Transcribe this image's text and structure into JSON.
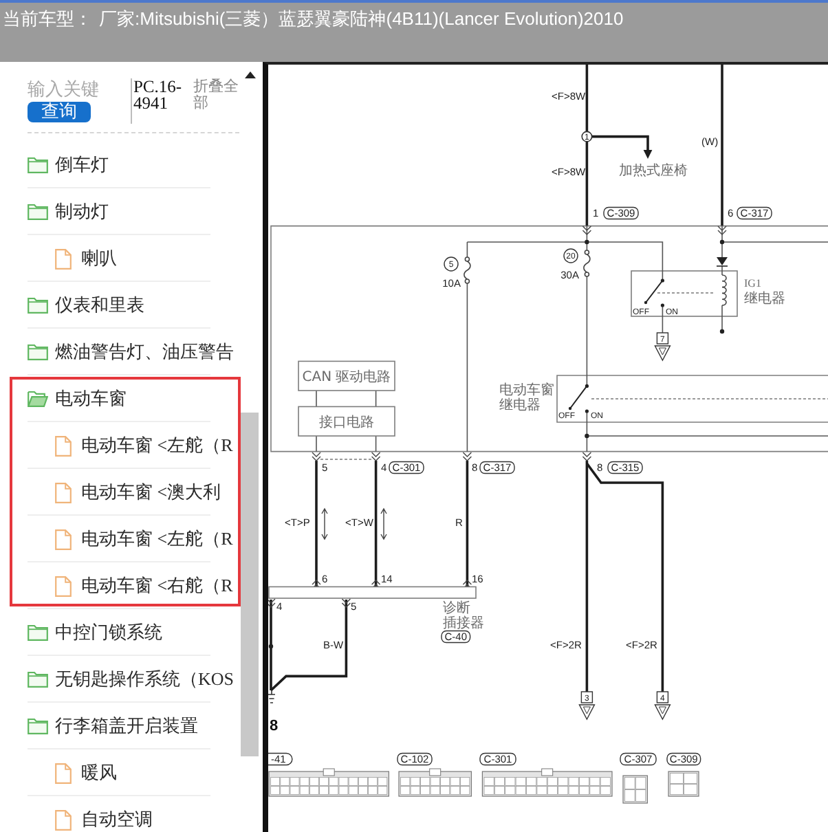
{
  "title_bar": {
    "label": "当前车型：",
    "value": "厂家:Mitsubishi(三菱）蓝瑟翼豪陆神(4B11)(Lancer Evolution)2010"
  },
  "sidebar": {
    "search": {
      "placeholder": "输入关键",
      "button": "查询"
    },
    "code": "PC.16-4941",
    "collapse_all": "折叠全部",
    "tree": [
      {
        "label": "倒车灯",
        "kind": "folder",
        "expanded": false,
        "highlighted": false
      },
      {
        "label": "制动灯",
        "kind": "folder",
        "expanded": false,
        "highlighted": false,
        "children": [
          {
            "label": "喇叭",
            "kind": "file"
          }
        ]
      },
      {
        "label": "仪表和里表",
        "kind": "folder",
        "expanded": false,
        "highlighted": false
      },
      {
        "label": "燃油警告灯、油压警告",
        "kind": "folder",
        "expanded": false,
        "highlighted": false
      },
      {
        "label": "电动车窗",
        "kind": "folder",
        "expanded": true,
        "highlighted": true,
        "children": [
          {
            "label": "电动车窗 <左舵（R",
            "kind": "file"
          },
          {
            "label": "电动车窗 <澳大利",
            "kind": "file"
          },
          {
            "label": "电动车窗 <左舵（R",
            "kind": "file"
          },
          {
            "label": "电动车窗 <右舵（R",
            "kind": "file"
          }
        ]
      },
      {
        "label": "中控门锁系统",
        "kind": "folder",
        "expanded": false,
        "highlighted": false
      },
      {
        "label": "无钥匙操作系统（KOS",
        "kind": "folder",
        "expanded": false,
        "highlighted": false
      },
      {
        "label": "行李箱盖开启装置",
        "kind": "folder",
        "expanded": false,
        "highlighted": false,
        "children": [
          {
            "label": "暖风",
            "kind": "file"
          },
          {
            "label": "自动空调",
            "kind": "file"
          }
        ]
      }
    ]
  },
  "wiring_diagram": {
    "wire_labels": [
      "<F>8W",
      "<F>8W",
      "(W)",
      "<T>P",
      "<T>W",
      "R",
      "B-W",
      "<F>2R",
      "<F>2R"
    ],
    "splice": "1",
    "branch_to": "加热式座椅",
    "terminals": [
      {
        "pin": "1",
        "connector": "C-309"
      },
      {
        "pin": "6",
        "connector": "C-317"
      },
      {
        "pin": "5"
      },
      {
        "pin": "4",
        "connector": "C-301"
      },
      {
        "pin": "8",
        "connector": "C-317"
      },
      {
        "pin": "8",
        "connector": "C-315"
      },
      {
        "pin": "6"
      },
      {
        "pin": "14"
      },
      {
        "pin": "16"
      },
      {
        "pin": "4"
      },
      {
        "pin": "5"
      }
    ],
    "fuses": [
      {
        "number": "5",
        "rating": "10A"
      },
      {
        "number": "20",
        "rating": "30A"
      }
    ],
    "ig1_relay": {
      "name": "IG1",
      "label": "继电器",
      "off": "OFF",
      "on": "ON",
      "closed": false
    },
    "window_relay": {
      "label": [
        "电动车窗",
        "继电器"
      ],
      "off": "OFF",
      "on": "ON",
      "closed": false
    },
    "circuit_blocks": [
      "CAN 驱动电路",
      "接口电路"
    ],
    "diagnostic_connector": {
      "label": [
        "诊断",
        "插接器"
      ],
      "connector": "C-40"
    },
    "off_page_links": [
      "7",
      "3",
      "4"
    ],
    "ground": "8",
    "connector_views": [
      "-41",
      "C-102",
      "C-301",
      "C-307",
      "C-309"
    ]
  }
}
